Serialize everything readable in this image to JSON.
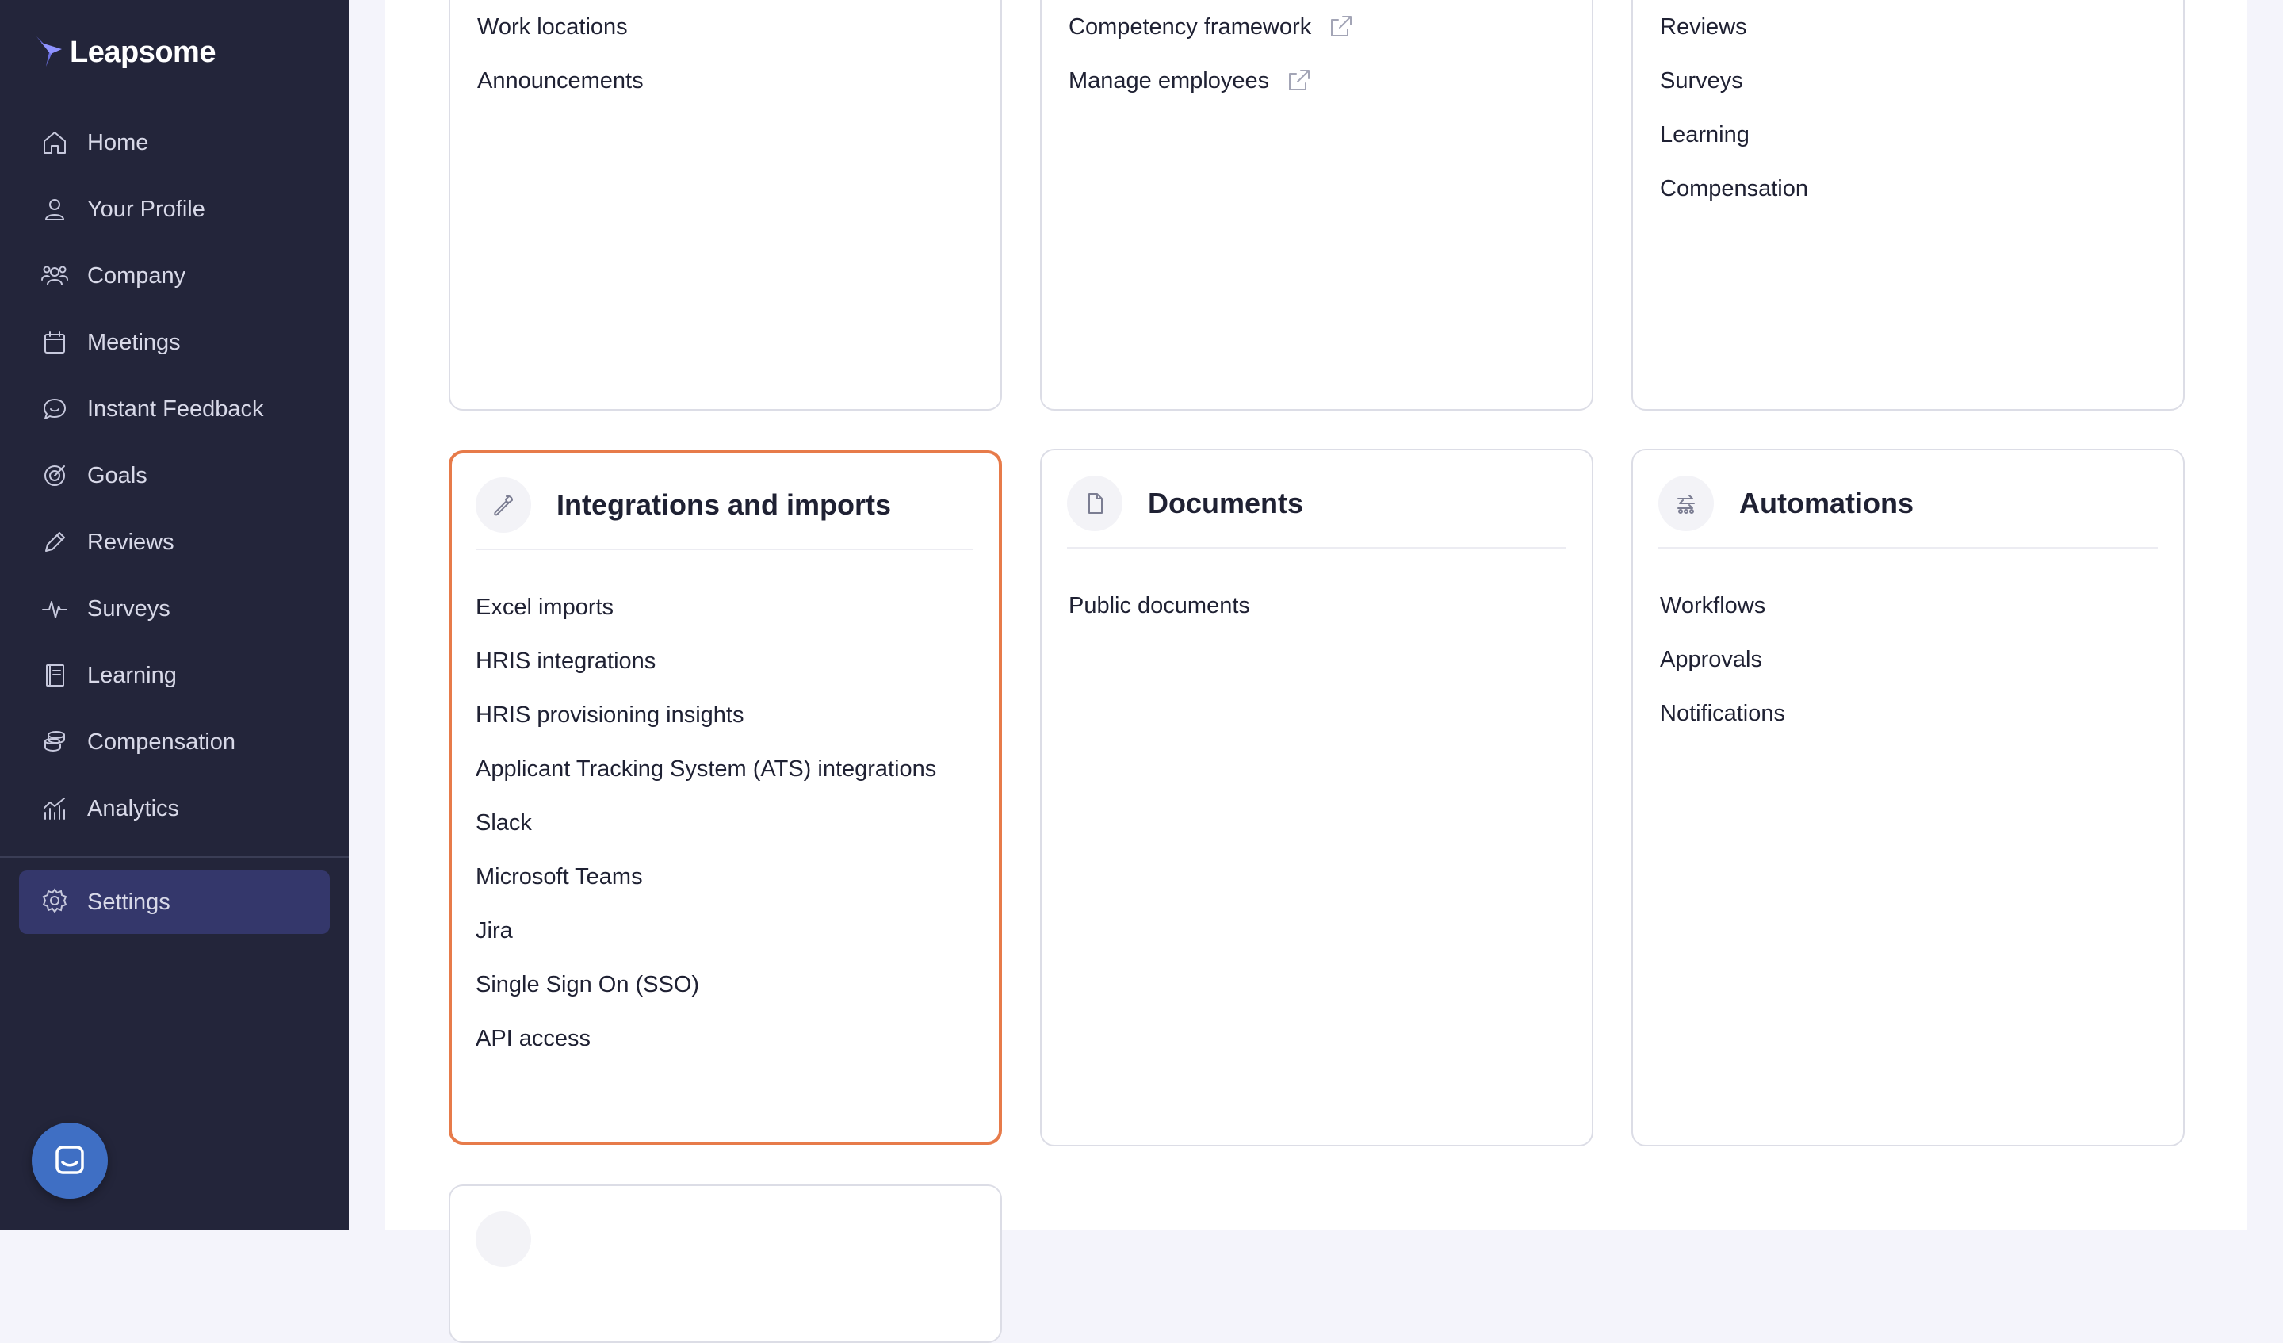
{
  "brand": {
    "name": "Leapsome"
  },
  "nav": {
    "items": [
      {
        "label": "Home",
        "icon": "home-icon"
      },
      {
        "label": "Your Profile",
        "icon": "user-icon"
      },
      {
        "label": "Company",
        "icon": "users-icon"
      },
      {
        "label": "Meetings",
        "icon": "calendar-icon"
      },
      {
        "label": "Instant Feedback",
        "icon": "chat-icon"
      },
      {
        "label": "Goals",
        "icon": "target-icon"
      },
      {
        "label": "Reviews",
        "icon": "pencil-icon"
      },
      {
        "label": "Surveys",
        "icon": "pulse-icon"
      },
      {
        "label": "Learning",
        "icon": "book-icon"
      },
      {
        "label": "Compensation",
        "icon": "coins-icon"
      },
      {
        "label": "Analytics",
        "icon": "chart-icon"
      }
    ],
    "settings": {
      "label": "Settings",
      "icon": "gear-icon"
    }
  },
  "cards": {
    "top_left": {
      "items": [
        "Work locations",
        "Announcements"
      ]
    },
    "top_middle": {
      "items": [
        "Competency framework",
        "Manage employees"
      ]
    },
    "top_right": {
      "items": [
        "Reviews",
        "Surveys",
        "Learning",
        "Compensation"
      ]
    },
    "integrations": {
      "title": "Integrations and imports",
      "icon": "wrench-icon",
      "items": [
        "Excel imports",
        "HRIS integrations",
        "HRIS provisioning insights",
        "Applicant Tracking System (ATS) integrations",
        "Slack",
        "Microsoft Teams",
        "Jira",
        "Single Sign On (SSO)",
        "API access"
      ]
    },
    "documents": {
      "title": "Documents",
      "icon": "document-icon",
      "items": [
        "Public documents"
      ]
    },
    "automations": {
      "title": "Automations",
      "icon": "automation-icon",
      "items": [
        "Workflows",
        "Approvals",
        "Notifications"
      ]
    }
  },
  "colors": {
    "sidebar": "#23253a",
    "active_nav": "#34376b",
    "highlight_border": "#e77b4a",
    "chat_button": "#3f6fc4"
  }
}
